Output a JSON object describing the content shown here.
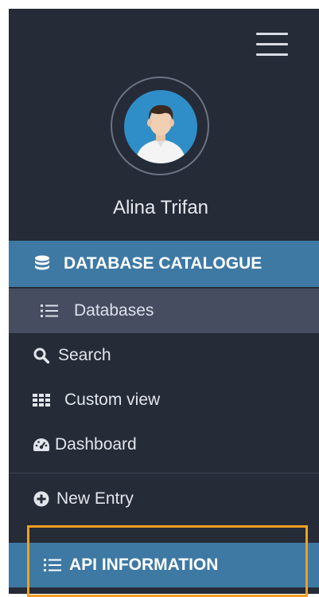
{
  "sidebar": {
    "user_name": "Alina Trifan",
    "section_header": {
      "label": "DATABASE CATALOGUE",
      "icon": "database-icon"
    },
    "items": [
      {
        "label": "Databases",
        "icon": "list-icon"
      },
      {
        "label": "Search",
        "icon": "search-icon"
      },
      {
        "label": "Custom view",
        "icon": "grid-icon"
      },
      {
        "label": "Dashboard",
        "icon": "dashboard-icon"
      },
      {
        "label": "New Entry",
        "icon": "plus-circle-icon"
      }
    ],
    "api_header": {
      "label": "API INFORMATION",
      "icon": "list-icon"
    }
  },
  "colors": {
    "sidebar_bg": "#262b38",
    "accent": "#3e79a4",
    "active_item_bg": "#474d60",
    "highlight": "#f0a020",
    "avatar_bg": "#2f8ec7"
  }
}
